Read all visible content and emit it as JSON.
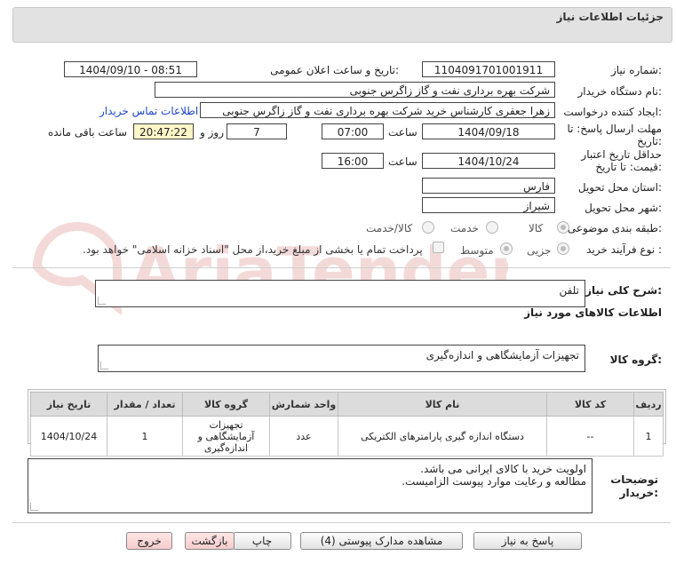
{
  "header": {
    "title": "جزئیات اطلاعات نیاز"
  },
  "form": {
    "need_number": {
      "label": "شماره نیاز:",
      "value": "1104091701001911"
    },
    "announce_datetime": {
      "label": "تاریخ و ساعت اعلان عمومی:",
      "value": "1404/09/10 - 08:51"
    },
    "buyer_org": {
      "label": "نام دستگاه خریدار:",
      "value": "شرکت بهره برداری نفت و گاز زاگرس جنوبی"
    },
    "creator": {
      "label": "ایجاد کننده درخواست:",
      "value": "زهرا جعفری کارشناس خرید شرکت بهره برداری نفت و گاز زاگرس جنوبی",
      "contact_link": "اطلاعات تماس خریدار"
    },
    "reply_deadline": {
      "label_line1": "مهلت ارسال پاسخ: تا",
      "label_line2": "تاریخ:",
      "date": "1404/09/18",
      "time_label": "ساعت",
      "time": "07:00",
      "days": "7",
      "days_label": "روز و",
      "remaining": "20:47:22",
      "remaining_label": "ساعت باقی مانده"
    },
    "price_validity": {
      "label_line1": "حداقل تاریخ اعتبار",
      "label_line2": "قیمت: تا تاریخ:",
      "date": "1404/10/24",
      "time_label": "ساعت",
      "time": "16:00"
    },
    "delivery_province": {
      "label": "استان محل تحویل:",
      "value": "فارس"
    },
    "delivery_city": {
      "label": "شهر محل تحویل:",
      "value": "شیراز"
    },
    "category": {
      "label": "طبقه بندی موضوعی:",
      "options": [
        "کالا",
        "خدمت",
        "کالا/خدمت"
      ],
      "selected": "کالا"
    },
    "process_type": {
      "label": "نوع فرآیند خرید :",
      "options": [
        "جزیی",
        "متوسط"
      ],
      "selected": "جزیی",
      "checkbox_text": "پرداخت تمام یا بخشی از مبلغ خرید،از محل \"اسناد خزانه اسلامی\" خواهد بود."
    }
  },
  "summary": {
    "label": "شرح کلی نیاز:",
    "value": "تلفن"
  },
  "goods_section": {
    "title": "اطلاعات کالاهای مورد نیاز"
  },
  "goods_group": {
    "label": "گروه کالا:",
    "value": "تجهیزات آزمایشگاهی و اندازه‌گیری"
  },
  "table": {
    "headers": [
      "ردیف",
      "کد کالا",
      "نام کالا",
      "واحد شمارش",
      "گروه کالا",
      "تعداد / مقدار",
      "تاریخ نیاز"
    ],
    "rows": [
      {
        "row": "1",
        "code": "--",
        "name": "دستگاه اندازه گیری پارامترهای الکتریکی",
        "unit": "عدد",
        "group_line1": "تجهیزات",
        "group_line2": "آزمایشگاهی و",
        "group_line3": "اندازه‌گیری",
        "qty": "1",
        "date": "1404/10/24"
      }
    ]
  },
  "notes": {
    "label_line1": "توضیحات",
    "label_line2": "خریدار:",
    "line1": "اولویت خرید با کالای ایرانی می باشد.",
    "line2": "مطالعه و رعایت موارد پیوست الزامیست."
  },
  "buttons": {
    "reply": "پاسخ به نیاز",
    "attachments": "مشاهده مدارک پیوستی (4)",
    "print": "چاپ",
    "back": "بازگشت",
    "exit": "خروج"
  },
  "watermark": {
    "text": "AriaTender.neT"
  }
}
